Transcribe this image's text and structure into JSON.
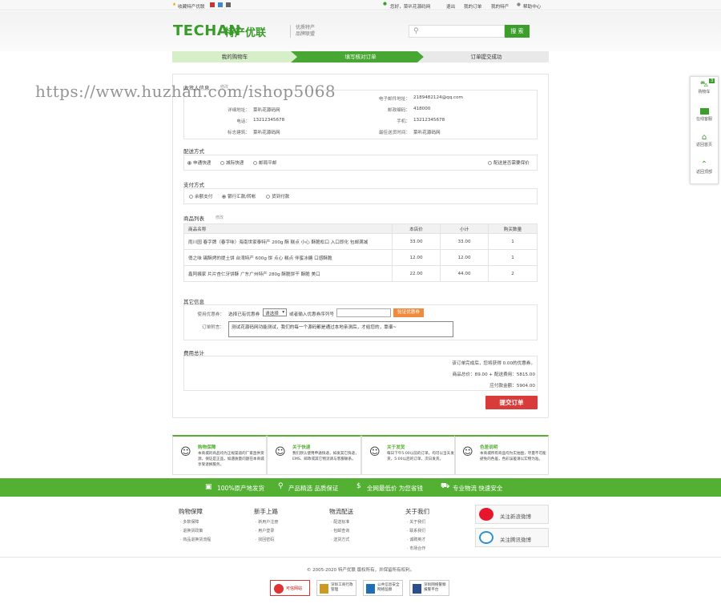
{
  "topbar": {
    "fav": "收藏特产优联",
    "welcome": "您好，菜叭花源码网",
    "logout": "退出",
    "orders": "我的订单",
    "my_shop": "我的特产",
    "help": "帮助中心"
  },
  "header": {
    "logo": "TECHAN",
    "logo_cn": "特产优联",
    "slogan1": "优质特产",
    "slogan2": "品牌联盟",
    "search_btn": "搜 索"
  },
  "steps": [
    "我的购物车",
    "填写核对订单",
    "订单提交成功"
  ],
  "watermark": "https://www.huzhan.com/ishop5068",
  "receiver": {
    "title": "收货人信息",
    "edit": "修改",
    "rows": [
      {
        "l1": "详细地址：",
        "v1": "菜叭花源码网",
        "l2": "邮政编码：",
        "v2": "418000"
      },
      {
        "l1": "电话：",
        "v1": "13212345678",
        "l2": "手机：",
        "v2": "13212345678"
      },
      {
        "l1": "标志建筑：",
        "v1": "菜叭花源码网",
        "l2": "最佳送货时间：",
        "v2": "菜叭花源码网"
      }
    ],
    "email_label": "电子邮件地址：",
    "email": "2189482124@qq.com"
  },
  "shipping": {
    "title": "配送方式",
    "options": [
      "申通快递",
      "城际快递",
      "邮局平邮"
    ],
    "insure": "配送是否需要保价"
  },
  "payment": {
    "title": "支付方式",
    "options": [
      "余额支付",
      "银行汇款/转帐",
      "货到付款"
    ]
  },
  "goods": {
    "title": "商品列表",
    "edit": "修改",
    "headers": [
      "商品名称",
      "本店价",
      "小计",
      "购买数量"
    ],
    "rows": [
      {
        "name": "雨川园 春字牌（春字味）海南世家泰特产 200g 酥 糕点 小心 酥脆松口 入口即化 包邮满减",
        "price": "33.00",
        "subtotal": "33.00",
        "qty": "1"
      },
      {
        "name": "俏之味 锡酥烤的提土饼 台湾特产 600g 饼 点心 糕点 伴蜜冰糖 口感酥脆",
        "price": "12.00",
        "subtotal": "12.00",
        "qty": "1"
      },
      {
        "name": "鑫阿姨家 片片杏仁牙饼酥 广东广州特产 280g 酥脆饼干 酥脆 美口",
        "price": "22.00",
        "subtotal": "44.00",
        "qty": "2"
      }
    ]
  },
  "other": {
    "title": "其它信息",
    "coupon_label": "使用优惠券：",
    "coupon_text": "选择已有优惠券",
    "coupon_select": "请选择",
    "coupon_or": "或者输入优惠券序列号",
    "coupon_btn": "验证优惠券",
    "msg_label": "订单附言：",
    "msg": "测试花源码网功能测试，我们的每一个源码都是通过本地亲测后，才给您的，靠谱~"
  },
  "totals": {
    "title": "费用总计",
    "line1": "该订单完成后，您将获得 0.00的优惠券。",
    "line2": "商品总价：89.00 + 配送费用：5815.00",
    "line3": "应付款金额：5904.00",
    "submit": "提交订单"
  },
  "services": [
    {
      "title": "购物保障",
      "text": "本商城的商品均为正规渠道的厂家直供货源，保证是正品，如遇质量问题在本商城享受退换服务。"
    },
    {
      "title": "关于快递",
      "text": "我们默认使用申通快递，如发其它快递，EMS、邮政或其它物流请与客服联系。"
    },
    {
      "title": "关于发货",
      "text": "每日下午5:00以前的订单，均可以当天发货，5:00以后的订单，次日发货。"
    },
    {
      "title": "色差说明",
      "text": "本商城所有商品均为实拍图，尽量不可能避免的色差，色彩误差请以实物为准。"
    }
  ],
  "features": [
    "100%原产地发货",
    "产品精选 品质保证",
    "全网最低价 为您省钱",
    "专业物流 快速安全"
  ],
  "footer_cols": [
    {
      "title": "购物保障",
      "items": [
        "多数保障",
        "退换货政策",
        "商品退换货流程"
      ]
    },
    {
      "title": "新手上路",
      "items": [
        "新用户注册",
        "用户登录",
        "找回密码"
      ]
    },
    {
      "title": "物流配送",
      "items": [
        "配送标准",
        "包邮查询",
        "送货方式"
      ]
    },
    {
      "title": "关于我们",
      "items": [
        "关于我们",
        "联系我们",
        "诚聘英才",
        "市场合作"
      ]
    }
  ],
  "social": [
    "关注新浪微博",
    "关注腾讯微博"
  ],
  "copyright": "© 2005-2020 特产优联 版权所有，并保留所有权利。",
  "badges": [
    "可信网站",
    "深圳工商行政管理",
    "公共信息安全网络监察",
    "深圳网络警察报警平台"
  ],
  "rside": [
    "购物车",
    "在线客服",
    "返回首页",
    "返回顶部"
  ],
  "cart_count": "3"
}
